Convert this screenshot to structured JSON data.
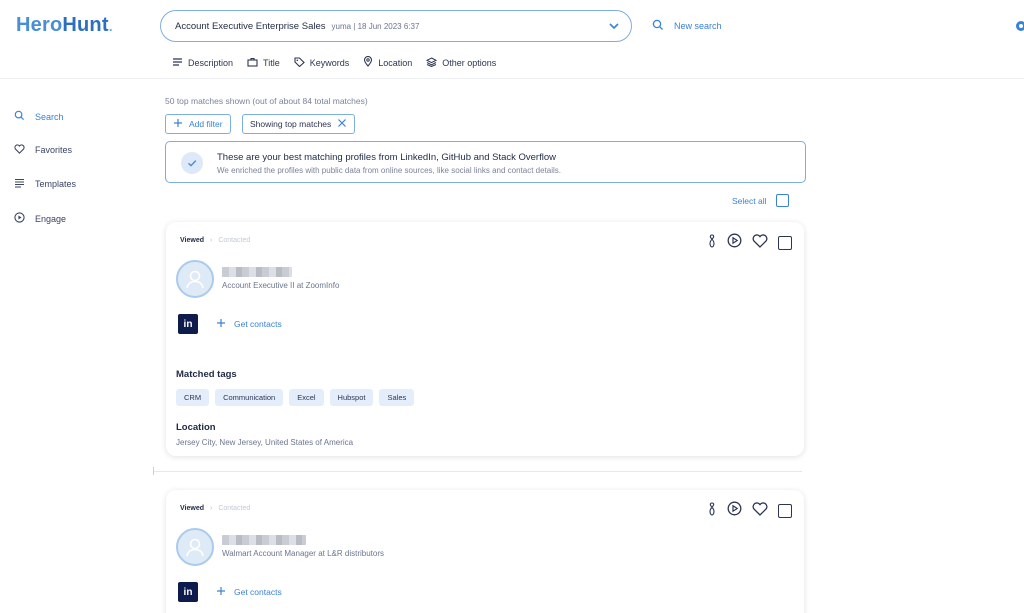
{
  "app": {
    "logo_hero": "Hero",
    "logo_hunt": "Hunt",
    "logo_dot": "."
  },
  "search": {
    "query": "Account Executive Enterprise Sales",
    "meta": "yuma  |  18 Jun 2023 6:37",
    "new_search_label": "New search"
  },
  "tabs": [
    {
      "label": "Description",
      "icon": "lines-icon"
    },
    {
      "label": "Title",
      "icon": "briefcase-icon"
    },
    {
      "label": "Keywords",
      "icon": "tag-icon"
    },
    {
      "label": "Location",
      "icon": "pin-icon"
    },
    {
      "label": "Other options",
      "icon": "layers-icon"
    }
  ],
  "sidebar": {
    "items": [
      {
        "label": "Search",
        "icon": "search-icon",
        "active": true
      },
      {
        "label": "Favorites",
        "icon": "heart-icon"
      },
      {
        "label": "Templates",
        "icon": "list-icon"
      },
      {
        "label": "Engage",
        "icon": "play-circle-icon"
      }
    ]
  },
  "results": {
    "match_count": "50 top matches shown (out of about 84 total matches)",
    "add_filter_label": "Add filter",
    "showing_label": "Showing top matches",
    "banner_title": "These are your best matching profiles from LinkedIn, GitHub and Stack Overflow",
    "banner_sub": "We enriched the profiles with public data from online sources, like social links and contact details.",
    "select_all_label": "Select all"
  },
  "cards": [
    {
      "viewed": "Viewed",
      "contacted": "Contacted",
      "role": "Account Executive II at ZoomInfo",
      "linkedin": "in",
      "get_contacts": "Get contacts",
      "matched_tags_title": "Matched tags",
      "tags": [
        "CRM",
        "Communication",
        "Excel",
        "Hubspot",
        "Sales"
      ],
      "location_title": "Location",
      "location": "Jersey City, New Jersey, United States of America"
    },
    {
      "viewed": "Viewed",
      "contacted": "Contacted",
      "role": "Walmart Account Manager at L&R distributors",
      "linkedin": "in",
      "get_contacts": "Get contacts"
    }
  ],
  "colors": {
    "accent": "#3a82d6",
    "border": "#7eaee0",
    "text": "#2c3553",
    "tag_bg": "#e4eefb",
    "linkedin": "#0e1b4d"
  }
}
